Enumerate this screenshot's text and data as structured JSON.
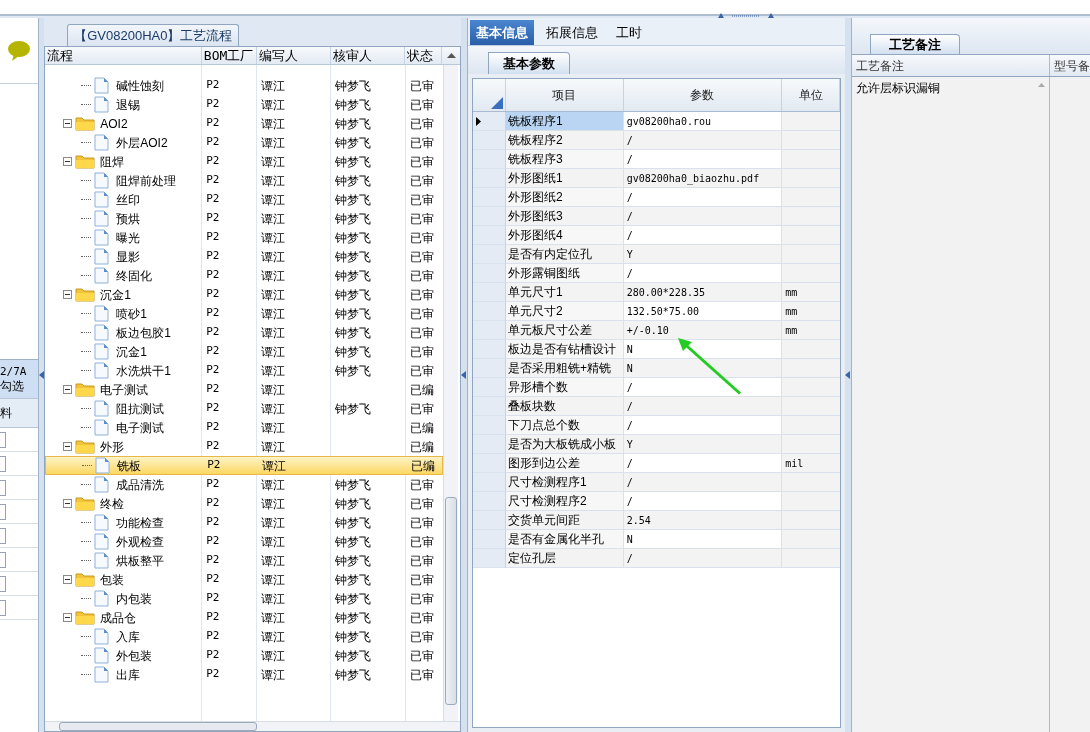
{
  "side_strip": {
    "header_line_1": "2/7A",
    "header_line_2": "勾选",
    "column": "料",
    "rows": [
      {
        "checked": false
      },
      {
        "checked": false
      },
      {
        "checked": false
      },
      {
        "checked": false
      },
      {
        "checked": false
      },
      {
        "checked": false
      },
      {
        "checked": false
      },
      {
        "checked": false
      }
    ]
  },
  "process_panel": {
    "title": "【GV08200HA0】工艺流程",
    "columns": [
      "流程",
      "BOM工厂",
      "编写人",
      "核审人",
      "状态"
    ],
    "rows": [
      {
        "kind": "continued",
        "children": [
          {
            "kind": "file",
            "label": "碱性蚀刻",
            "bom": "P2",
            "writer": "谭江",
            "reviewer": "钟梦飞",
            "status": "已审",
            "selected": false
          },
          {
            "kind": "file",
            "label": "退锡",
            "bom": "P2",
            "writer": "谭江",
            "reviewer": "钟梦飞",
            "status": "已审",
            "selected": false
          }
        ]
      },
      {
        "kind": "folder",
        "label": "AOI2",
        "expanded": true,
        "bom": "P2",
        "writer": "谭江",
        "reviewer": "钟梦飞",
        "status": "已审",
        "selected": false,
        "children": [
          {
            "kind": "file",
            "label": "外层AOI2",
            "bom": "P2",
            "writer": "谭江",
            "reviewer": "钟梦飞",
            "status": "已审",
            "selected": false
          }
        ]
      },
      {
        "kind": "folder",
        "label": "阻焊",
        "expanded": true,
        "bom": "P2",
        "writer": "谭江",
        "reviewer": "钟梦飞",
        "status": "已审",
        "selected": false,
        "children": [
          {
            "kind": "file",
            "label": "阻焊前处理",
            "bom": "P2",
            "writer": "谭江",
            "reviewer": "钟梦飞",
            "status": "已审",
            "selected": false
          },
          {
            "kind": "file",
            "label": "丝印",
            "bom": "P2",
            "writer": "谭江",
            "reviewer": "钟梦飞",
            "status": "已审",
            "selected": false
          },
          {
            "kind": "file",
            "label": "预烘",
            "bom": "P2",
            "writer": "谭江",
            "reviewer": "钟梦飞",
            "status": "已审",
            "selected": false
          },
          {
            "kind": "file",
            "label": "曝光",
            "bom": "P2",
            "writer": "谭江",
            "reviewer": "钟梦飞",
            "status": "已审",
            "selected": false
          },
          {
            "kind": "file",
            "label": "显影",
            "bom": "P2",
            "writer": "谭江",
            "reviewer": "钟梦飞",
            "status": "已审",
            "selected": false
          },
          {
            "kind": "file",
            "label": "终固化",
            "bom": "P2",
            "writer": "谭江",
            "reviewer": "钟梦飞",
            "status": "已审",
            "selected": false
          }
        ]
      },
      {
        "kind": "folder",
        "label": "沉金1",
        "expanded": true,
        "bom": "P2",
        "writer": "谭江",
        "reviewer": "钟梦飞",
        "status": "已审",
        "selected": false,
        "children": [
          {
            "kind": "file",
            "label": "喷砂1",
            "bom": "P2",
            "writer": "谭江",
            "reviewer": "钟梦飞",
            "status": "已审",
            "selected": false
          },
          {
            "kind": "file",
            "label": "板边包胶1",
            "bom": "P2",
            "writer": "谭江",
            "reviewer": "钟梦飞",
            "status": "已审",
            "selected": false
          },
          {
            "kind": "file",
            "label": "沉金1",
            "bom": "P2",
            "writer": "谭江",
            "reviewer": "钟梦飞",
            "status": "已审",
            "selected": false
          },
          {
            "kind": "file",
            "label": "水洗烘干1",
            "bom": "P2",
            "writer": "谭江",
            "reviewer": "钟梦飞",
            "status": "已审",
            "selected": false
          }
        ]
      },
      {
        "kind": "folder",
        "label": "电子测试",
        "expanded": true,
        "bom": "P2",
        "writer": "谭江",
        "status": "已编",
        "selected": false,
        "children": [
          {
            "kind": "file",
            "label": "阻抗测试",
            "bom": "P2",
            "writer": "谭江",
            "reviewer": "钟梦飞",
            "status": "已审",
            "selected": false
          },
          {
            "kind": "file",
            "label": "电子测试",
            "bom": "P2",
            "writer": "谭江",
            "status": "已编",
            "selected": false
          }
        ]
      },
      {
        "kind": "folder",
        "label": "外形",
        "expanded": true,
        "bom": "P2",
        "writer": "谭江",
        "status": "已编",
        "selected": false,
        "children": [
          {
            "kind": "file",
            "label": "铣板",
            "bom": "P2",
            "writer": "谭江",
            "status": "已编",
            "selected": true
          },
          {
            "kind": "file",
            "label": "成品清洗",
            "bom": "P2",
            "writer": "谭江",
            "reviewer": "钟梦飞",
            "status": "已审",
            "selected": false
          }
        ]
      },
      {
        "kind": "folder",
        "label": "终检",
        "expanded": true,
        "bom": "P2",
        "writer": "谭江",
        "reviewer": "钟梦飞",
        "status": "已审",
        "selected": false,
        "children": [
          {
            "kind": "file",
            "label": "功能检查",
            "bom": "P2",
            "writer": "谭江",
            "reviewer": "钟梦飞",
            "status": "已审",
            "selected": false
          },
          {
            "kind": "file",
            "label": "外观检查",
            "bom": "P2",
            "writer": "谭江",
            "reviewer": "钟梦飞",
            "status": "已审",
            "selected": false
          },
          {
            "kind": "file",
            "label": "烘板整平",
            "bom": "P2",
            "writer": "谭江",
            "reviewer": "钟梦飞",
            "status": "已审",
            "selected": false
          }
        ]
      },
      {
        "kind": "folder",
        "label": "包装",
        "expanded": true,
        "bom": "P2",
        "writer": "谭江",
        "reviewer": "钟梦飞",
        "status": "已审",
        "selected": false,
        "children": [
          {
            "kind": "file",
            "label": "内包装",
            "bom": "P2",
            "writer": "谭江",
            "reviewer": "钟梦飞",
            "status": "已审",
            "selected": false
          }
        ]
      },
      {
        "kind": "folder",
        "label": "成品仓",
        "expanded": true,
        "bom": "P2",
        "writer": "谭江",
        "reviewer": "钟梦飞",
        "status": "已审",
        "selected": false,
        "children": [
          {
            "kind": "file",
            "label": "入库",
            "bom": "P2",
            "writer": "谭江",
            "reviewer": "钟梦飞",
            "status": "已审",
            "selected": false
          },
          {
            "kind": "file",
            "label": "外包装",
            "bom": "P2",
            "writer": "谭江",
            "reviewer": "钟梦飞",
            "status": "已审",
            "selected": false
          },
          {
            "kind": "file",
            "label": "出库",
            "bom": "P2",
            "writer": "谭江",
            "reviewer": "钟梦飞",
            "status": "已审",
            "selected": false
          }
        ]
      }
    ]
  },
  "detail_tabs": [
    {
      "label": "基本信息",
      "selected": true
    },
    {
      "label": "拓展信息",
      "selected": false
    },
    {
      "label": "工时",
      "selected": false
    }
  ],
  "params": {
    "tab": "基本参数",
    "columns": [
      "项目",
      "参数",
      "单位"
    ],
    "rows": [
      {
        "item": "铣板程序1",
        "value": "gv08200ha0.rou",
        "selected": true
      },
      {
        "item": "铣板程序2",
        "value": "/",
        "selected": false
      },
      {
        "item": "铣板程序3",
        "value": "/",
        "selected": false
      },
      {
        "item": "外形图纸1",
        "value": "gv08200ha0_biaozhu.pdf",
        "selected": false
      },
      {
        "item": "外形图纸2",
        "value": "/",
        "selected": false
      },
      {
        "item": "外形图纸3",
        "value": "/",
        "selected": false
      },
      {
        "item": "外形图纸4",
        "value": "/",
        "selected": false
      },
      {
        "item": "是否有内定位孔",
        "value": "Y",
        "selected": false
      },
      {
        "item": "外形露铜图纸",
        "value": "/",
        "selected": false
      },
      {
        "item": "单元尺寸1",
        "value": "280.00*228.35",
        "unit": "mm",
        "selected": false
      },
      {
        "item": "单元尺寸2",
        "value": "132.50*75.00",
        "unit": "mm",
        "selected": false
      },
      {
        "item": "单元板尺寸公差",
        "value": "+/-0.10",
        "unit": "mm",
        "selected": false
      },
      {
        "item": "板边是否有钻槽设计",
        "value": "N",
        "selected": false
      },
      {
        "item": "是否采用粗铣+精铣",
        "value": "N",
        "selected": false
      },
      {
        "item": "异形槽个数",
        "value": "/",
        "selected": false
      },
      {
        "item": "叠板块数",
        "value": "/",
        "selected": false
      },
      {
        "item": "下刀点总个数",
        "value": "/",
        "selected": false
      },
      {
        "item": "是否为大板铣成小板",
        "value": "Y",
        "selected": false
      },
      {
        "item": "图形到边公差",
        "value": "/",
        "unit": "mil",
        "selected": false
      },
      {
        "item": "尺寸检测程序1",
        "value": "/",
        "selected": false
      },
      {
        "item": "尺寸检测程序2",
        "value": "/",
        "selected": false
      },
      {
        "item": "交货单元间距",
        "value": "2.54",
        "selected": false
      },
      {
        "item": "是否有金属化半孔",
        "value": "N",
        "selected": false
      },
      {
        "item": "定位孔层",
        "value": "/",
        "selected": false
      }
    ]
  },
  "remarks": {
    "tab": "工艺备注",
    "columns": [
      "工艺备注",
      "型号备"
    ],
    "text": "允许层标识漏铜"
  }
}
